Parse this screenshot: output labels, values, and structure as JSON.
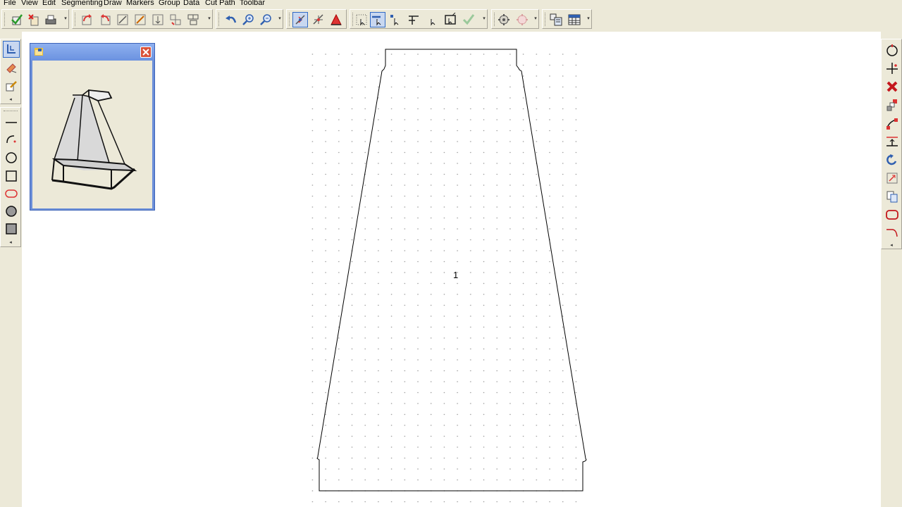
{
  "menu": {
    "items": [
      "File",
      "View",
      "Edit",
      "Segmenting",
      "Draw",
      "Markers",
      "Group",
      "Data",
      "Cut Path",
      "Toolbar"
    ]
  },
  "toolbar": {
    "icons": [
      "save-check-icon",
      "close-file-icon",
      "print-icon",
      "rotate-right-icon",
      "rotate-left-icon",
      "scale-icon",
      "stretch-icon",
      "align-icon",
      "mirror-icon",
      "group-icon",
      "undo-icon",
      "zoom-in-icon",
      "zoom-out-icon",
      "select-point-icon",
      "move-point-icon",
      "add-point-icon",
      "select-all-icon",
      "select-segment-icon",
      "select-node-icon",
      "snap-icon",
      "select-box-icon",
      "accept-icon",
      "settings-icon",
      "settings-disabled-icon",
      "layout-icon",
      "grid-icon"
    ]
  },
  "left_tools": {
    "icons": [
      "marker-tool-icon",
      "eraser-icon",
      "edit-icon",
      "line-icon",
      "arc-icon",
      "circle-icon",
      "rectangle-icon",
      "rounded-rect-icon",
      "filled-circle-icon",
      "filled-rect-icon"
    ]
  },
  "right_tools": {
    "icons": [
      "circle-select-icon",
      "crosshair-icon",
      "delete-icon",
      "node-edit-icon",
      "curve-edit-icon",
      "align-top-icon",
      "rotate-icon",
      "resize-icon",
      "duplicate-icon",
      "round-rect-icon",
      "line-corner-icon"
    ]
  },
  "piece": {
    "label": "1"
  },
  "colors": {
    "accent": "#316ac5",
    "window_title": "#6b92e0",
    "close_red": "#d9523a",
    "canvas": "#ffffff",
    "chrome": "#ece9d8"
  }
}
